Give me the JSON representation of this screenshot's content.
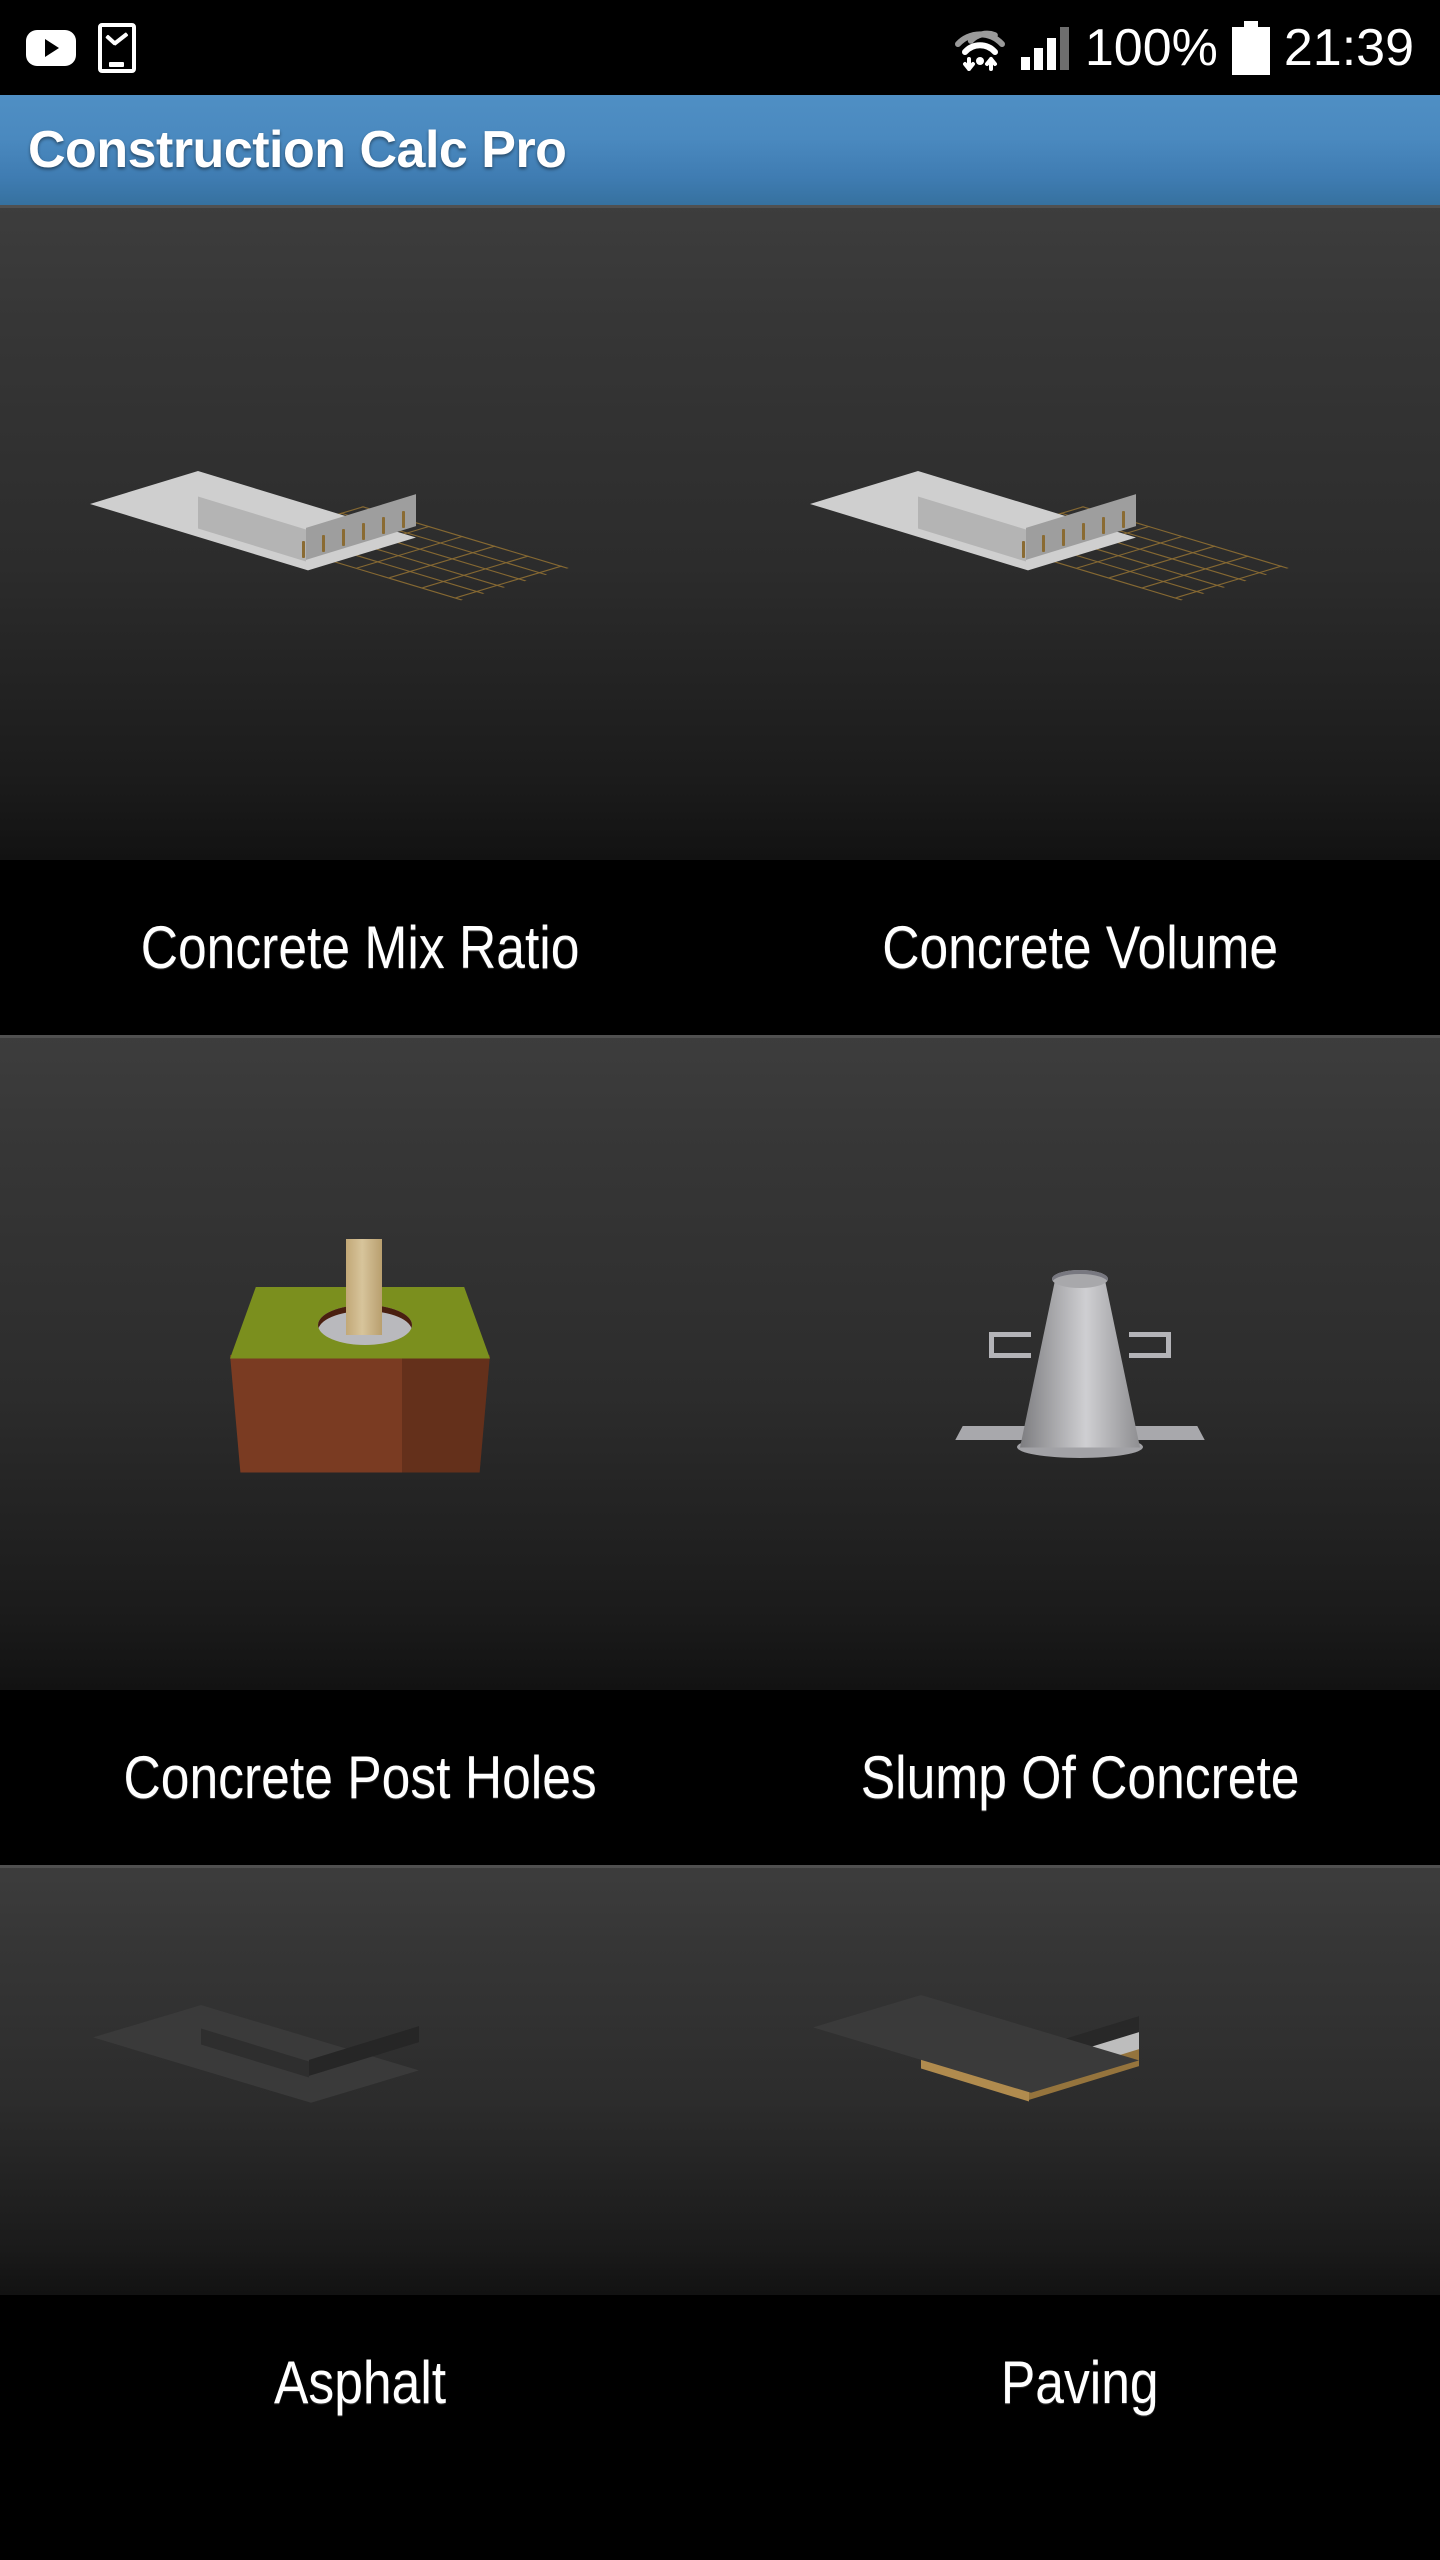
{
  "status_bar": {
    "left_icons": [
      {
        "name": "youtube-icon",
        "label": "YouTube"
      },
      {
        "name": "device-check-icon",
        "label": "Device check"
      }
    ],
    "right_icons": [
      {
        "name": "wifi-icon",
        "label": "Wi-Fi with data transfer"
      },
      {
        "name": "cellular-signal-icon",
        "label": "Cellular signal"
      },
      {
        "name": "battery-icon",
        "label": "Battery full"
      }
    ],
    "battery_percent": "100%",
    "clock": "21:39",
    "background_color": "#000000",
    "text_color": "#ffffff"
  },
  "app_bar": {
    "title": "Construction Calc Pro",
    "background_start": "#4f8fc4",
    "background_end": "#36719f",
    "text_color": "#ffffff"
  },
  "grid": {
    "columns": 2,
    "tile_background_top": "#3d3d3d",
    "tile_background_bottom": "#121212",
    "label_background": "#000000",
    "label_text_color": "#ffffff",
    "rows": [
      {
        "tiles": [
          {
            "label": "Concrete Mix Ratio",
            "icon": "concrete-slab-rebar-icon"
          },
          {
            "label": "Concrete Volume",
            "icon": "concrete-slab-rebar-icon"
          }
        ]
      },
      {
        "tiles": [
          {
            "label": "Concrete Post Holes",
            "icon": "post-hole-icon"
          },
          {
            "label": "Slump Of Concrete",
            "icon": "slump-cone-icon"
          }
        ]
      },
      {
        "tiles": [
          {
            "label": "Asphalt",
            "icon": "asphalt-slab-icon"
          },
          {
            "label": "Paving",
            "icon": "pavement-layers-icon"
          }
        ]
      }
    ]
  }
}
